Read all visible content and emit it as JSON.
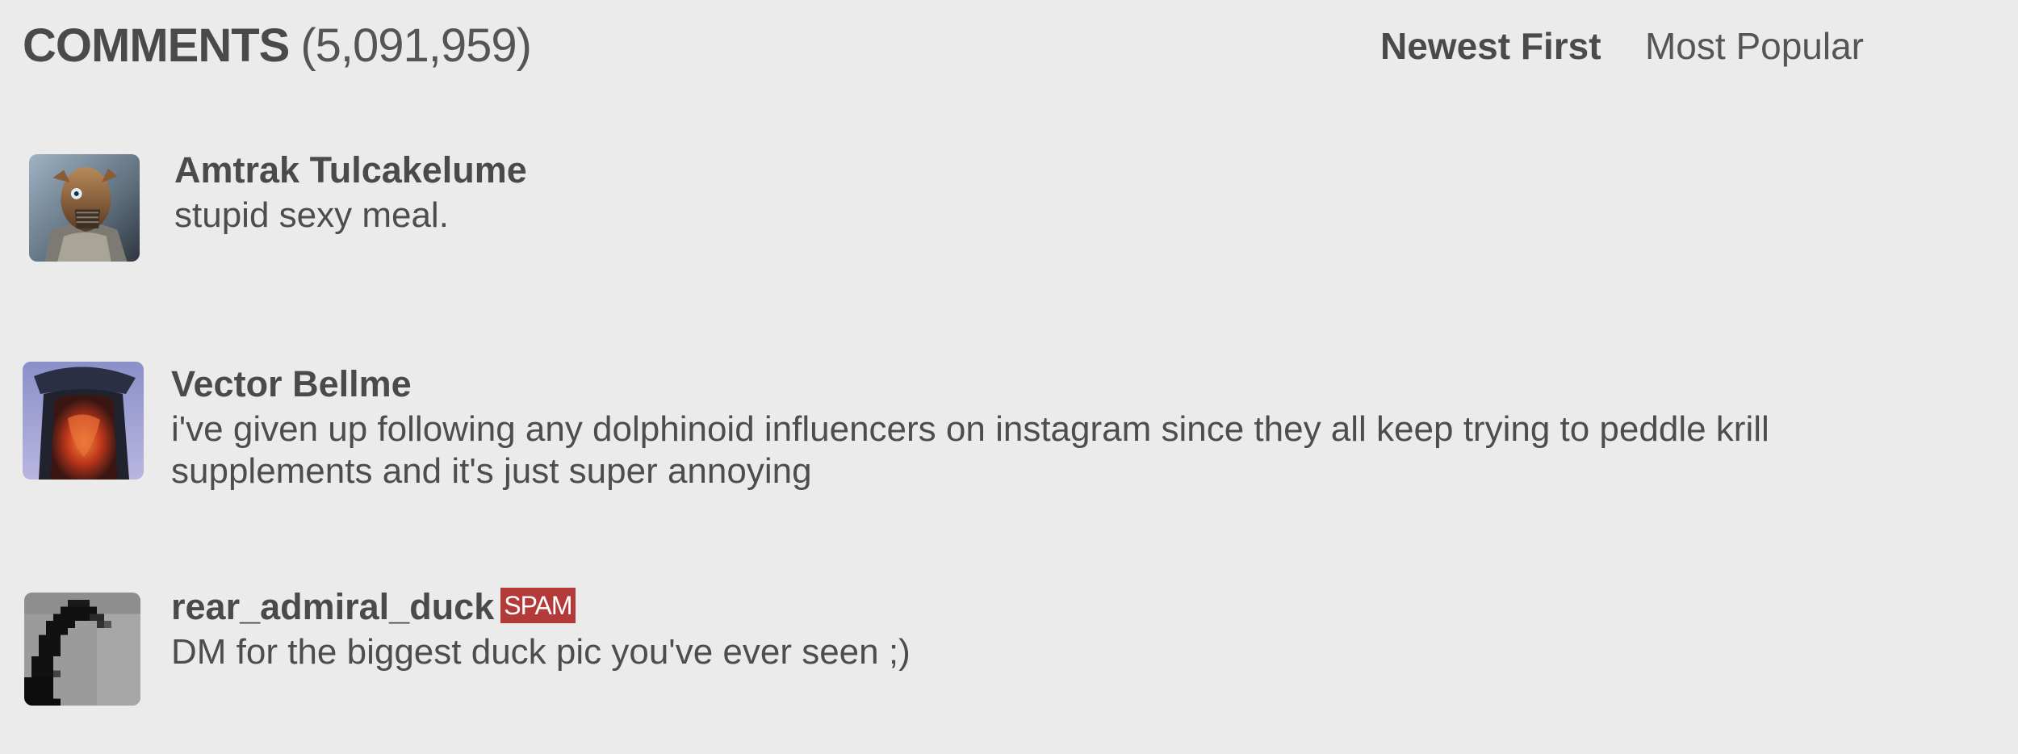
{
  "header": {
    "title": "COMMENTS",
    "count": "(5,091,959)",
    "sort_options": [
      "Newest First",
      "Most Popular"
    ],
    "active_sort": "Newest First"
  },
  "comments": [
    {
      "author": "Amtrak Tulcakelume",
      "text": "stupid sexy meal.",
      "avatar_icon": "armored-alien-avatar"
    },
    {
      "author": "Vector Bellme",
      "text": "i've given up following any dolphinoid influencers on instagram since they all keep trying to peddle krill supplements and it's just super annoying",
      "avatar_icon": "hooded-glowing-figure-avatar"
    },
    {
      "author": "rear_admiral_duck",
      "badge": "SPAM",
      "text": "DM for the biggest duck pic you've ever seen ;)",
      "avatar_icon": "pixelated-duck-silhouette-avatar"
    }
  ],
  "colors": {
    "background": "#ebebeb",
    "text": "#4a4a4a",
    "spam_badge": "#b43a3a"
  }
}
